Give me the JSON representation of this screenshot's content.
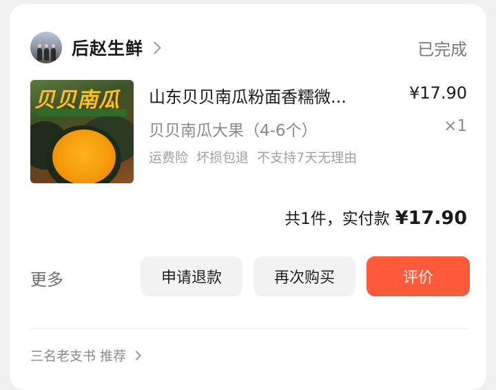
{
  "shop": {
    "name": "后赵生鲜",
    "status": "已完成"
  },
  "product": {
    "image_label": "贝贝南瓜",
    "name": "山东贝贝南瓜粉面香糯微...",
    "price": "¥17.90",
    "sku": "贝贝南瓜大果（4-6个）",
    "quantity": "×1",
    "services": [
      "运费险",
      "坏损包退",
      "不支持7天无理由"
    ]
  },
  "summary": {
    "label": "共1件，实付款",
    "amount": "¥17.90"
  },
  "actions": {
    "more_label": "更多",
    "refund_label": "申请退款",
    "rebuy_label": "再次购买",
    "review_label": "评价"
  },
  "recommend": {
    "label": "三名老支书 推荐"
  },
  "colors": {
    "accent": "#ff5a3c",
    "secondary_text": "#8a8a8a",
    "button_bg": "#f2f2f2"
  }
}
